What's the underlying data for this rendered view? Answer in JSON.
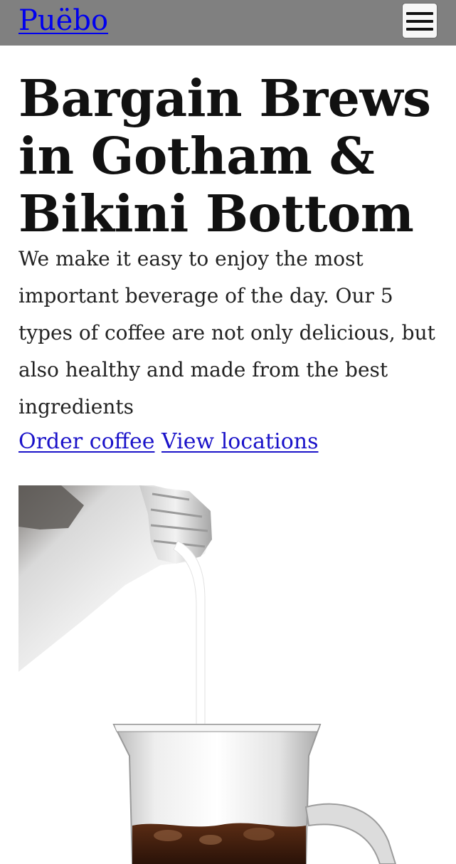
{
  "header": {
    "brand": "Puëbo",
    "menu_icon": "hamburger-menu-icon",
    "background": "#808080"
  },
  "hero": {
    "title": "Bargain Brews in Gotham & Bikini Bottom",
    "description": "We make it easy to enjoy the most important beverage of the day. Our 5 types of coffee are not only delicious, but also healthy and made from the best ingredients",
    "links": {
      "order": "Order coffee",
      "locations": "View locations"
    },
    "image_subject": "milk-pouring-into-iced-coffee-glass"
  },
  "colors": {
    "link": "#1a12c9",
    "text": "#111111",
    "header_bg": "#808080"
  }
}
